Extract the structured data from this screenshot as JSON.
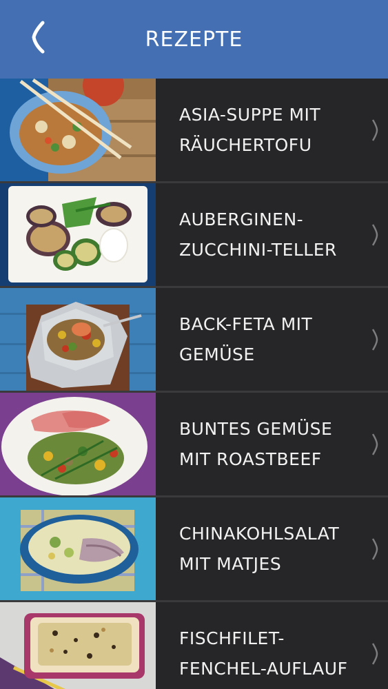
{
  "header": {
    "title": "REZEPTE",
    "back_icon": "chevron-left-icon",
    "color": "#4470b3"
  },
  "recipes": [
    {
      "title": "ASIA-SUPPE MIT RÄUCHERTOFU"
    },
    {
      "title": "AUBERGINEN-ZUCCHINI-TELLER"
    },
    {
      "title": "BACK-FETA MIT GEMÜSE"
    },
    {
      "title": "BUNTES GEMÜSE MIT ROASTBEEF"
    },
    {
      "title": "CHINAKOHLSALAT MIT MATJES"
    },
    {
      "title": "FISCHFILET-FENCHEL-AUFLAUF"
    }
  ]
}
